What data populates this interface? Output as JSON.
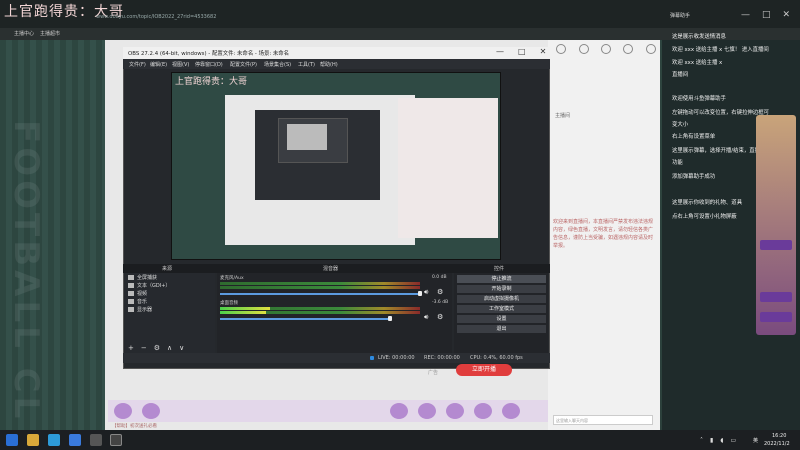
{
  "browser": {
    "logo": "上官跑得贵：大哥",
    "url": "www.douyu.com/topic/IOB2022_27rid=4533682",
    "bookmarks": [
      "主播中心",
      "主播超市"
    ],
    "window_icons": [
      "—",
      "□",
      "✕"
    ]
  },
  "page": {
    "vertical_text": "FOOTBALL CL",
    "chat_title": "主播间",
    "chat_text": "欢迎来到直播间，本直播间严禁发布违法违规内容，绿色直播，文明发言，请勿轻信各类广告信息，谨防上当受骗，如遇违规内容请及时举报。",
    "input_placeholder": "这里输入聊天内容",
    "gift_bar_text": "【帮助】初次送礼必看",
    "open_stream_label": "立即开播",
    "ad_label": "广告"
  },
  "announcements": [
    "弹幕助手",
    "这是展示收发送情消息",
    "欢迎 xxx 送给主播 x 七旗！ 进入直播间",
    "欢迎 xxx 送给主播 x",
    "直播间",
    "欢迎使用斗鱼弹幕助手",
    "左键拖动可以改变位置，右键拉伸边框可",
    "变大小",
    "右上角有设置菜单",
    "这里展示弹幕，选择开播/结束，直播提示",
    "功能",
    "添加弹幕助手成功",
    "这里展示你收到的礼物、道具",
    "点右上角可设置小礼物屏蔽"
  ],
  "obs": {
    "title": "OBS 27.2.4 (64-bit, windows) - 配置文件: 未命名 - 场景: 未命名",
    "menu": [
      "文件(F)",
      "编辑(E)",
      "视图(V)",
      "停靠窗口(D)",
      "配置文件(P)",
      "场景集合(S)",
      "工具(T)",
      "帮助(H)"
    ],
    "preview_logo": "上官跑得贵：大哥",
    "dock_headers": {
      "sources": "来源",
      "mixer": "混音器",
      "controls": "控件"
    },
    "sources": [
      {
        "name": "全屏捕获",
        "icon": "monitor-icon"
      },
      {
        "name": "文本（GDI+）",
        "icon": "text-icon"
      },
      {
        "name": "视频",
        "icon": "video-icon"
      },
      {
        "name": "音乐",
        "icon": "music-icon"
      },
      {
        "name": "显示器",
        "icon": "display-icon"
      }
    ],
    "source_tools": [
      "+",
      "−",
      "⚙",
      "∧",
      "∨"
    ],
    "mixer": [
      {
        "label": "麦克风/Aux",
        "db": "0.0 dB"
      },
      {
        "label": "桌面音频",
        "db": "-3.6 dB"
      }
    ],
    "controls": [
      "停止推流",
      "开始录制",
      "启动虚拟摄像机",
      "工作室模式",
      "设置",
      "退出"
    ],
    "status": {
      "live": "LIVE: 00:00:00",
      "rec": "REC: 00:00:00",
      "cpu": "CPU: 0.4%, 60.00 fps"
    }
  },
  "taskbar": {
    "time": "16:20",
    "date": "2022/11/2",
    "lang": "英"
  }
}
